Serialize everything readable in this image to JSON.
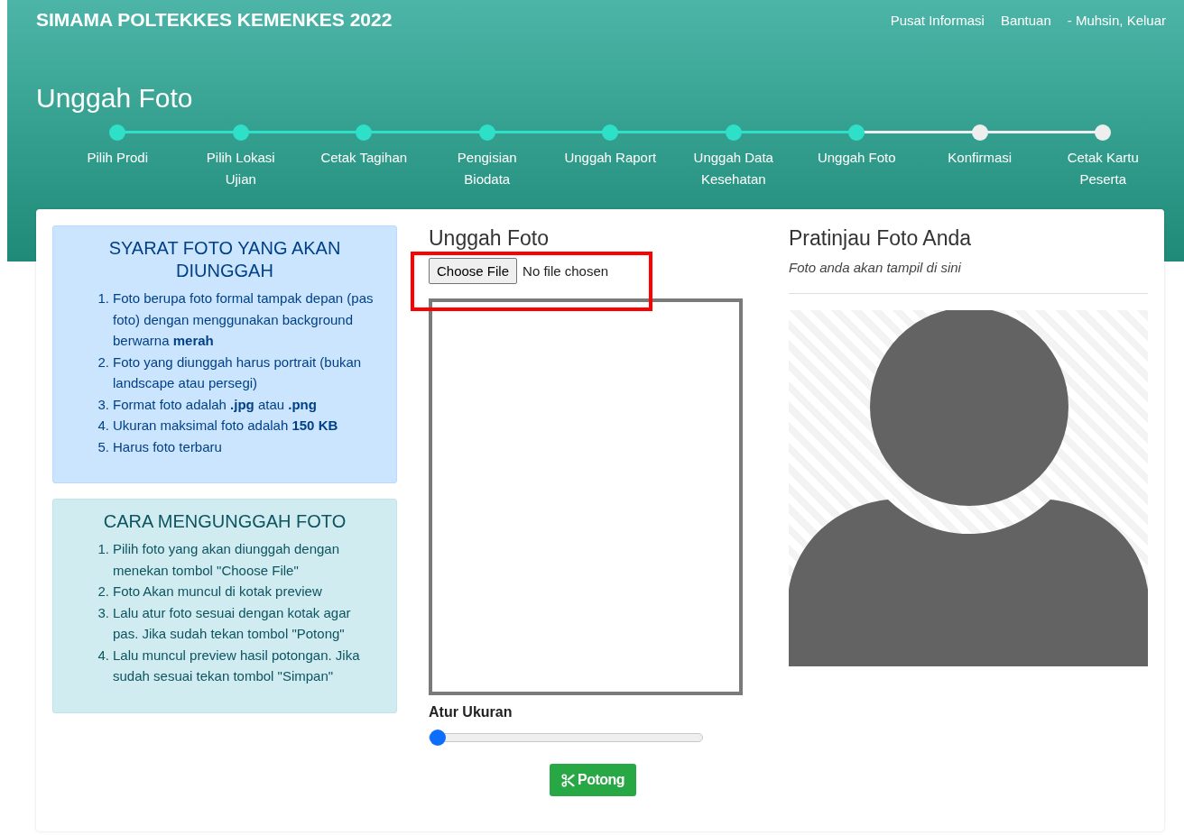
{
  "header": {
    "brand": "SIMAMA POLTEKKES KEMENKES 2022",
    "nav": [
      "Pusat Informasi",
      "Bantuan",
      "- Muhsin, Keluar"
    ],
    "page_title": "Unggah Foto"
  },
  "steps": [
    {
      "label": "Pilih Prodi",
      "done": true
    },
    {
      "label": "Pilih Lokasi Ujian",
      "done": true
    },
    {
      "label": "Cetak Tagihan",
      "done": true
    },
    {
      "label": "Pengisian Biodata",
      "done": true
    },
    {
      "label": "Unggah Raport",
      "done": true
    },
    {
      "label": "Unggah Data Kesehatan",
      "done": true
    },
    {
      "label": "Unggah Foto",
      "done": true
    },
    {
      "label": "Konfirmasi",
      "done": false
    },
    {
      "label": "Cetak Kartu Peserta",
      "done": false
    }
  ],
  "panels": [
    {
      "kind": "primary",
      "title": "SYARAT FOTO YANG AKAN DIUNGGAH",
      "items": [
        {
          "marker": "1.",
          "text": "Foto berupa foto formal tampak depan (pas foto) dengan menggunakan background berwarna **merah**"
        },
        {
          "marker": "2.",
          "text": "Foto yang diunggah harus portrait (bukan landscape atau persegi)"
        },
        {
          "marker": "3.",
          "text": "Format foto adalah **.jpg** atau **.png**"
        },
        {
          "marker": "4.",
          "text": "Ukuran maksimal foto adalah **150 KB**"
        },
        {
          "marker": "5.",
          "text": "Harus foto terbaru"
        }
      ]
    },
    {
      "kind": "info",
      "title": "CARA MENGUNGGAH FOTO",
      "items": [
        {
          "marker": "1.",
          "text": "Pilih foto yang akan diunggah dengan menekan tombol \"Choose File\""
        },
        {
          "marker": "2.",
          "text": "Foto Akan muncul di kotak preview"
        },
        {
          "marker": "3.",
          "text": "Lalu atur foto sesuai dengan kotak agar pas. Jika sudah tekan tombol \"Potong\""
        },
        {
          "marker": "4.",
          "text": "Lalu muncul preview hasil potongan. Jika sudah sesuai tekan tombol \"Simpan\""
        }
      ]
    }
  ],
  "upload": {
    "title": "Unggah Foto",
    "file_button": "Choose File",
    "file_status": "No file chosen",
    "size_label": "Atur Ukuran",
    "size_slider": {
      "level": 0
    },
    "crop_button": "Potong"
  },
  "preview": {
    "title": "Pratinjau Foto Anda",
    "subtitle": "Foto anda akan tampil di sini"
  }
}
